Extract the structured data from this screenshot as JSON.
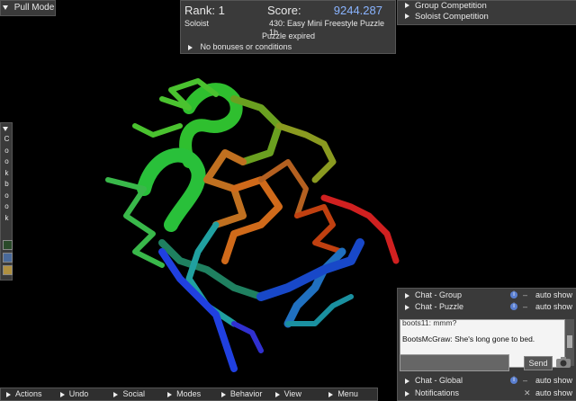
{
  "pull_mode": {
    "label": "Pull Mode"
  },
  "score_panel": {
    "rank": "Rank: 1",
    "score_label": "Score:",
    "score_value": "9244.287",
    "mode": "Soloist",
    "puzzle": "430: Easy Mini Freestyle Puzzle 1b",
    "status": "Puzzle expired",
    "bonuses": "No bonuses or conditions"
  },
  "competitions": {
    "items": [
      "Group Competition",
      "Soloist Competition"
    ]
  },
  "cookbook": {
    "letters": [
      "C",
      "o",
      "o",
      "k",
      "b",
      "o",
      "o",
      "k"
    ]
  },
  "chat": {
    "group": {
      "label": "Chat - Group",
      "auto": "auto show"
    },
    "puzzle": {
      "label": "Chat - Puzzle",
      "auto": "auto show"
    },
    "log_prev": "boots11: mmm?",
    "log_user": "BootsMcGraw",
    "log_msg": ": She's long gone to  bed.",
    "send": "Send",
    "global": {
      "label": "Chat - Global",
      "auto": "auto show"
    },
    "notifications": {
      "label": "Notifications",
      "auto": "auto show"
    }
  },
  "bottom_menu": {
    "items": [
      "Actions",
      "Undo",
      "Social",
      "Modes",
      "Behavior",
      "View",
      "Menu"
    ]
  },
  "colors": {
    "score": "#8ab4ff",
    "panel": "#3a3a3a"
  }
}
